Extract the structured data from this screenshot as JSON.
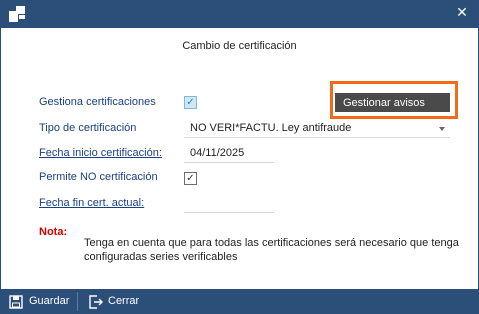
{
  "window": {
    "close_glyph": "✕",
    "app_icon": "app-window-icon"
  },
  "dialog": {
    "title": "Cambio de certificación"
  },
  "form": {
    "gestiona_label": "Gestiona certificaciones",
    "gestiona_checked": true,
    "tipo_label": "Tipo de certificación",
    "tipo_value": "NO VERI*FACTU. Ley antifraude",
    "fecha_inicio_label": "Fecha inicio certificación:",
    "fecha_inicio_value": "04/11/2025",
    "permite_label": "Permite NO certificación",
    "permite_checked": true,
    "fecha_fin_label": "Fecha fin cert. actual:",
    "fecha_fin_value": ""
  },
  "avisos_button": {
    "label": "Gestionar avisos",
    "highlight_color": "#f26a1b"
  },
  "note": {
    "label": "Nota:",
    "text": "Tenga en cuenta que para todas las certificaciones será necesario que tenga configuradas series verificables"
  },
  "footer": {
    "save_label": "Guardar",
    "close_label": "Cerrar"
  },
  "colors": {
    "titlebar": "#2b4f79",
    "label_blue": "#1a3f86",
    "note_red": "#d60000",
    "button_dark": "#4a4a4a"
  }
}
